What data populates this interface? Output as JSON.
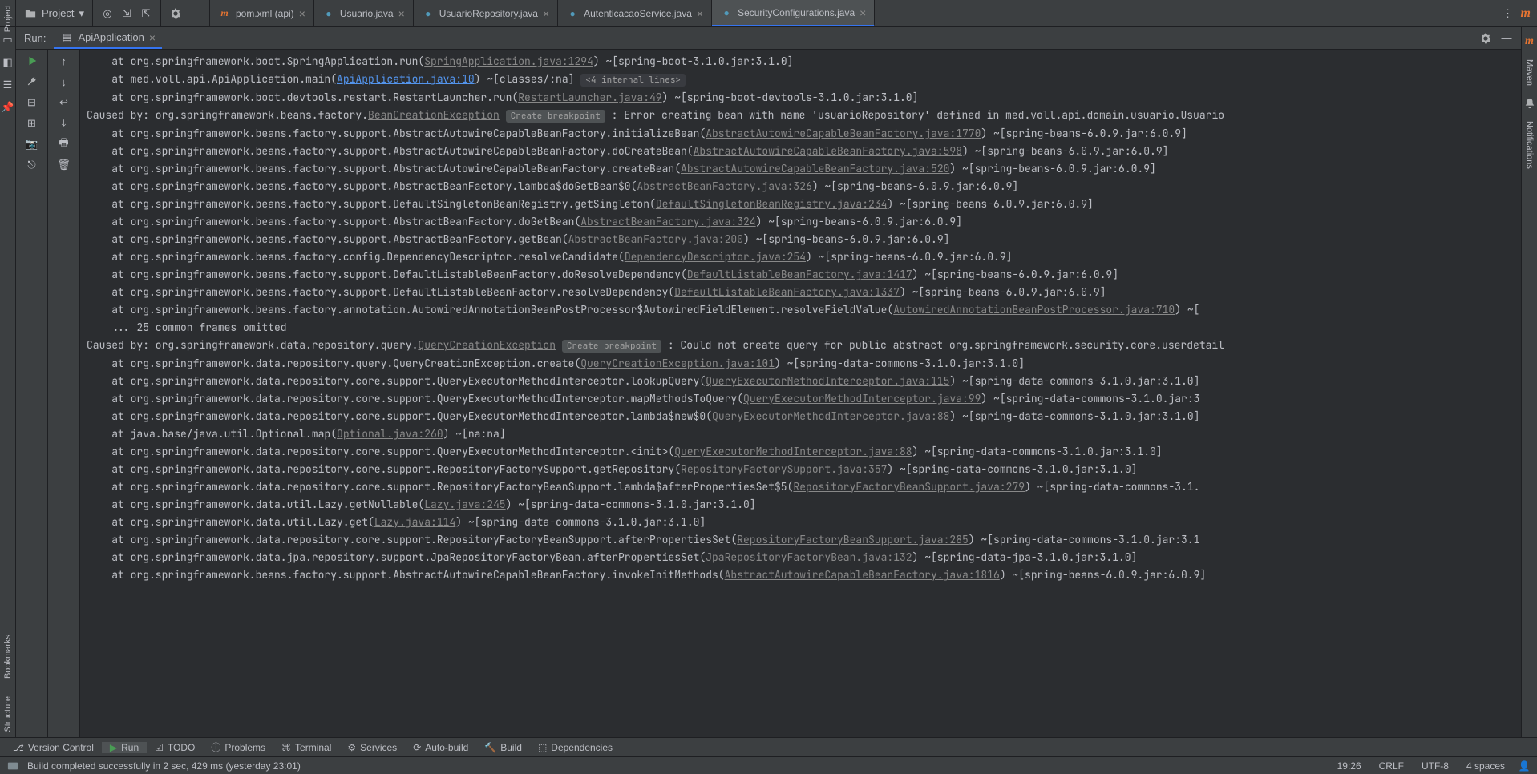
{
  "project_dropdown": {
    "label": "Project"
  },
  "tabs": [
    {
      "label": "pom.xml (api)",
      "icon": "maven",
      "active": false
    },
    {
      "label": "Usuario.java",
      "icon": "java",
      "active": false
    },
    {
      "label": "UsuarioRepository.java",
      "icon": "java",
      "active": false
    },
    {
      "label": "AutenticacaoService.java",
      "icon": "java",
      "active": false
    },
    {
      "label": "SecurityConfigurations.java",
      "icon": "java",
      "active": true
    }
  ],
  "run": {
    "label": "Run:",
    "config": "ApiApplication"
  },
  "right_rail": {
    "maven": "Maven",
    "notifications": "Notifications"
  },
  "left_rail": {
    "project": "Project",
    "bookmarks": "Bookmarks",
    "structure": "Structure"
  },
  "bottom_tabs": [
    {
      "label": "Version Control",
      "active": false
    },
    {
      "label": "Run",
      "active": true
    },
    {
      "label": "TODO",
      "active": false
    },
    {
      "label": "Problems",
      "active": false
    },
    {
      "label": "Terminal",
      "active": false
    },
    {
      "label": "Services",
      "active": false
    },
    {
      "label": "Auto-build",
      "active": false
    },
    {
      "label": "Build",
      "active": false
    },
    {
      "label": "Dependencies",
      "active": false
    }
  ],
  "status": {
    "message": "Build completed successfully in 2 sec, 429 ms (yesterday 23:01)",
    "time": "19:26",
    "line_ending": "CRLF",
    "encoding": "UTF-8",
    "indent": "4 spaces"
  },
  "console_lines": [
    {
      "segments": [
        {
          "t": "    at org.springframework.boot.SpringApplication.run("
        },
        {
          "t": "SpringApplication.java:1294",
          "cls": "link"
        },
        {
          "t": ") ~[spring-boot-3.1.0.jar:3.1.0]"
        }
      ]
    },
    {
      "segments": [
        {
          "t": "    at med.voll.api.ApiApplication.main("
        },
        {
          "t": "ApiApplication.java:10",
          "cls": "link-blue"
        },
        {
          "t": ") ~[classes/:na] "
        },
        {
          "t": "<4 internal lines>",
          "cls": "hint"
        }
      ]
    },
    {
      "segments": [
        {
          "t": "    at org.springframework.boot.devtools.restart.RestartLauncher.run("
        },
        {
          "t": "RestartLauncher.java:49",
          "cls": "link"
        },
        {
          "t": ") ~[spring-boot-devtools-3.1.0.jar:3.1.0]"
        }
      ]
    },
    {
      "segments": [
        {
          "t": "Caused by: org.springframework.beans.factory."
        },
        {
          "t": "BeanCreationException",
          "cls": "link"
        },
        {
          "t": " "
        },
        {
          "t": "Create breakpoint",
          "cls": "badge"
        },
        {
          "t": " : Error creating bean with name 'usuarioRepository' defined in med.voll.api.domain.usuario.Usuario"
        }
      ]
    },
    {
      "segments": [
        {
          "t": "    at org.springframework.beans.factory.support.AbstractAutowireCapableBeanFactory.initializeBean("
        },
        {
          "t": "AbstractAutowireCapableBeanFactory.java:1770",
          "cls": "link"
        },
        {
          "t": ") ~[spring-beans-6.0.9.jar:6.0.9]"
        }
      ]
    },
    {
      "segments": [
        {
          "t": "    at org.springframework.beans.factory.support.AbstractAutowireCapableBeanFactory.doCreateBean("
        },
        {
          "t": "AbstractAutowireCapableBeanFactory.java:598",
          "cls": "link"
        },
        {
          "t": ") ~[spring-beans-6.0.9.jar:6.0.9]"
        }
      ]
    },
    {
      "segments": [
        {
          "t": "    at org.springframework.beans.factory.support.AbstractAutowireCapableBeanFactory.createBean("
        },
        {
          "t": "AbstractAutowireCapableBeanFactory.java:520",
          "cls": "link"
        },
        {
          "t": ") ~[spring-beans-6.0.9.jar:6.0.9]"
        }
      ]
    },
    {
      "segments": [
        {
          "t": "    at org.springframework.beans.factory.support.AbstractBeanFactory.lambda$doGetBean$0("
        },
        {
          "t": "AbstractBeanFactory.java:326",
          "cls": "link"
        },
        {
          "t": ") ~[spring-beans-6.0.9.jar:6.0.9]"
        }
      ]
    },
    {
      "segments": [
        {
          "t": "    at org.springframework.beans.factory.support.DefaultSingletonBeanRegistry.getSingleton("
        },
        {
          "t": "DefaultSingletonBeanRegistry.java:234",
          "cls": "link"
        },
        {
          "t": ") ~[spring-beans-6.0.9.jar:6.0.9]"
        }
      ]
    },
    {
      "segments": [
        {
          "t": "    at org.springframework.beans.factory.support.AbstractBeanFactory.doGetBean("
        },
        {
          "t": "AbstractBeanFactory.java:324",
          "cls": "link"
        },
        {
          "t": ") ~[spring-beans-6.0.9.jar:6.0.9]"
        }
      ]
    },
    {
      "segments": [
        {
          "t": "    at org.springframework.beans.factory.support.AbstractBeanFactory.getBean("
        },
        {
          "t": "AbstractBeanFactory.java:200",
          "cls": "link"
        },
        {
          "t": ") ~[spring-beans-6.0.9.jar:6.0.9]"
        }
      ]
    },
    {
      "segments": [
        {
          "t": "    at org.springframework.beans.factory.config.DependencyDescriptor.resolveCandidate("
        },
        {
          "t": "DependencyDescriptor.java:254",
          "cls": "link"
        },
        {
          "t": ") ~[spring-beans-6.0.9.jar:6.0.9]"
        }
      ]
    },
    {
      "segments": [
        {
          "t": "    at org.springframework.beans.factory.support.DefaultListableBeanFactory.doResolveDependency("
        },
        {
          "t": "DefaultListableBeanFactory.java:1417",
          "cls": "link"
        },
        {
          "t": ") ~[spring-beans-6.0.9.jar:6.0.9]"
        }
      ]
    },
    {
      "segments": [
        {
          "t": "    at org.springframework.beans.factory.support.DefaultListableBeanFactory.resolveDependency("
        },
        {
          "t": "DefaultListableBeanFactory.java:1337",
          "cls": "link"
        },
        {
          "t": ") ~[spring-beans-6.0.9.jar:6.0.9]"
        }
      ]
    },
    {
      "segments": [
        {
          "t": "    at org.springframework.beans.factory.annotation.AutowiredAnnotationBeanPostProcessor$AutowiredFieldElement.resolveFieldValue("
        },
        {
          "t": "AutowiredAnnotationBeanPostProcessor.java:710",
          "cls": "link"
        },
        {
          "t": ") ~["
        }
      ]
    },
    {
      "segments": [
        {
          "t": "    ... 25 common frames omitted"
        }
      ]
    },
    {
      "segments": [
        {
          "t": "Caused by: org.springframework.data.repository.query."
        },
        {
          "t": "QueryCreationException",
          "cls": "link"
        },
        {
          "t": " "
        },
        {
          "t": "Create breakpoint",
          "cls": "badge"
        },
        {
          "t": " : Could not create query for public abstract org.springframework.security.core.userdetail"
        }
      ]
    },
    {
      "segments": [
        {
          "t": "    at org.springframework.data.repository.query.QueryCreationException.create("
        },
        {
          "t": "QueryCreationException.java:101",
          "cls": "link"
        },
        {
          "t": ") ~[spring-data-commons-3.1.0.jar:3.1.0]"
        }
      ]
    },
    {
      "segments": [
        {
          "t": "    at org.springframework.data.repository.core.support.QueryExecutorMethodInterceptor.lookupQuery("
        },
        {
          "t": "QueryExecutorMethodInterceptor.java:115",
          "cls": "link"
        },
        {
          "t": ") ~[spring-data-commons-3.1.0.jar:3.1.0]"
        }
      ]
    },
    {
      "segments": [
        {
          "t": "    at org.springframework.data.repository.core.support.QueryExecutorMethodInterceptor.mapMethodsToQuery("
        },
        {
          "t": "QueryExecutorMethodInterceptor.java:99",
          "cls": "link"
        },
        {
          "t": ") ~[spring-data-commons-3.1.0.jar:3"
        }
      ]
    },
    {
      "segments": [
        {
          "t": "    at org.springframework.data.repository.core.support.QueryExecutorMethodInterceptor.lambda$new$0("
        },
        {
          "t": "QueryExecutorMethodInterceptor.java:88",
          "cls": "link"
        },
        {
          "t": ") ~[spring-data-commons-3.1.0.jar:3.1.0]"
        }
      ]
    },
    {
      "segments": [
        {
          "t": "    at java.base/java.util.Optional.map("
        },
        {
          "t": "Optional.java:260",
          "cls": "link"
        },
        {
          "t": ") ~[na:na]"
        }
      ]
    },
    {
      "segments": [
        {
          "t": "    at org.springframework.data.repository.core.support.QueryExecutorMethodInterceptor.<init>("
        },
        {
          "t": "QueryExecutorMethodInterceptor.java:88",
          "cls": "link"
        },
        {
          "t": ") ~[spring-data-commons-3.1.0.jar:3.1.0]"
        }
      ]
    },
    {
      "segments": [
        {
          "t": "    at org.springframework.data.repository.core.support.RepositoryFactorySupport.getRepository("
        },
        {
          "t": "RepositoryFactorySupport.java:357",
          "cls": "link"
        },
        {
          "t": ") ~[spring-data-commons-3.1.0.jar:3.1.0]"
        }
      ]
    },
    {
      "segments": [
        {
          "t": "    at org.springframework.data.repository.core.support.RepositoryFactoryBeanSupport.lambda$afterPropertiesSet$5("
        },
        {
          "t": "RepositoryFactoryBeanSupport.java:279",
          "cls": "link"
        },
        {
          "t": ") ~[spring-data-commons-3.1."
        }
      ]
    },
    {
      "segments": [
        {
          "t": "    at org.springframework.data.util.Lazy.getNullable("
        },
        {
          "t": "Lazy.java:245",
          "cls": "link"
        },
        {
          "t": ") ~[spring-data-commons-3.1.0.jar:3.1.0]"
        }
      ]
    },
    {
      "segments": [
        {
          "t": "    at org.springframework.data.util.Lazy.get("
        },
        {
          "t": "Lazy.java:114",
          "cls": "link"
        },
        {
          "t": ") ~[spring-data-commons-3.1.0.jar:3.1.0]"
        }
      ]
    },
    {
      "segments": [
        {
          "t": "    at org.springframework.data.repository.core.support.RepositoryFactoryBeanSupport.afterPropertiesSet("
        },
        {
          "t": "RepositoryFactoryBeanSupport.java:285",
          "cls": "link"
        },
        {
          "t": ") ~[spring-data-commons-3.1.0.jar:3.1"
        }
      ]
    },
    {
      "segments": [
        {
          "t": "    at org.springframework.data.jpa.repository.support.JpaRepositoryFactoryBean.afterPropertiesSet("
        },
        {
          "t": "JpaRepositoryFactoryBean.java:132",
          "cls": "link"
        },
        {
          "t": ") ~[spring-data-jpa-3.1.0.jar:3.1.0]"
        }
      ]
    },
    {
      "segments": [
        {
          "t": "    at org.springframework.beans.factory.support.AbstractAutowireCapableBeanFactory.invokeInitMethods("
        },
        {
          "t": "AbstractAutowireCapableBeanFactory.java:1816",
          "cls": "link"
        },
        {
          "t": ") ~[spring-beans-6.0.9.jar:6.0.9]"
        }
      ]
    }
  ]
}
